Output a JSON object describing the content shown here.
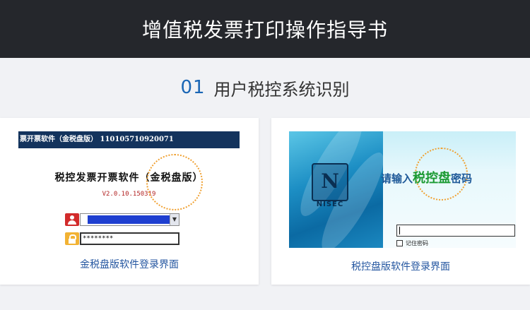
{
  "header": {
    "title": "增值税发票打印操作指导书"
  },
  "section": {
    "number": "01",
    "title": "用户税控系统识别"
  },
  "left_panel": {
    "window_title": "票开票软件（金税盘版） 110105710920071",
    "product_name": "税控发票开票软件（金税盘版）",
    "version": "V2.0.10.150319",
    "password_masked": "********",
    "caption": "金税盘版软件登录界面"
  },
  "right_panel": {
    "logo_letter": "N",
    "logo_text": "NISEC",
    "prompt_prefix": "请输入",
    "prompt_highlight": "税控盘",
    "prompt_suffix": "密码",
    "remember_label": "记住密码",
    "caption": "税控盘版软件登录界面"
  },
  "colors": {
    "header_bg": "#25272c",
    "accent_blue": "#1a66b5",
    "caption_blue": "#2456a0",
    "highlight_circle": "#f0a030"
  }
}
